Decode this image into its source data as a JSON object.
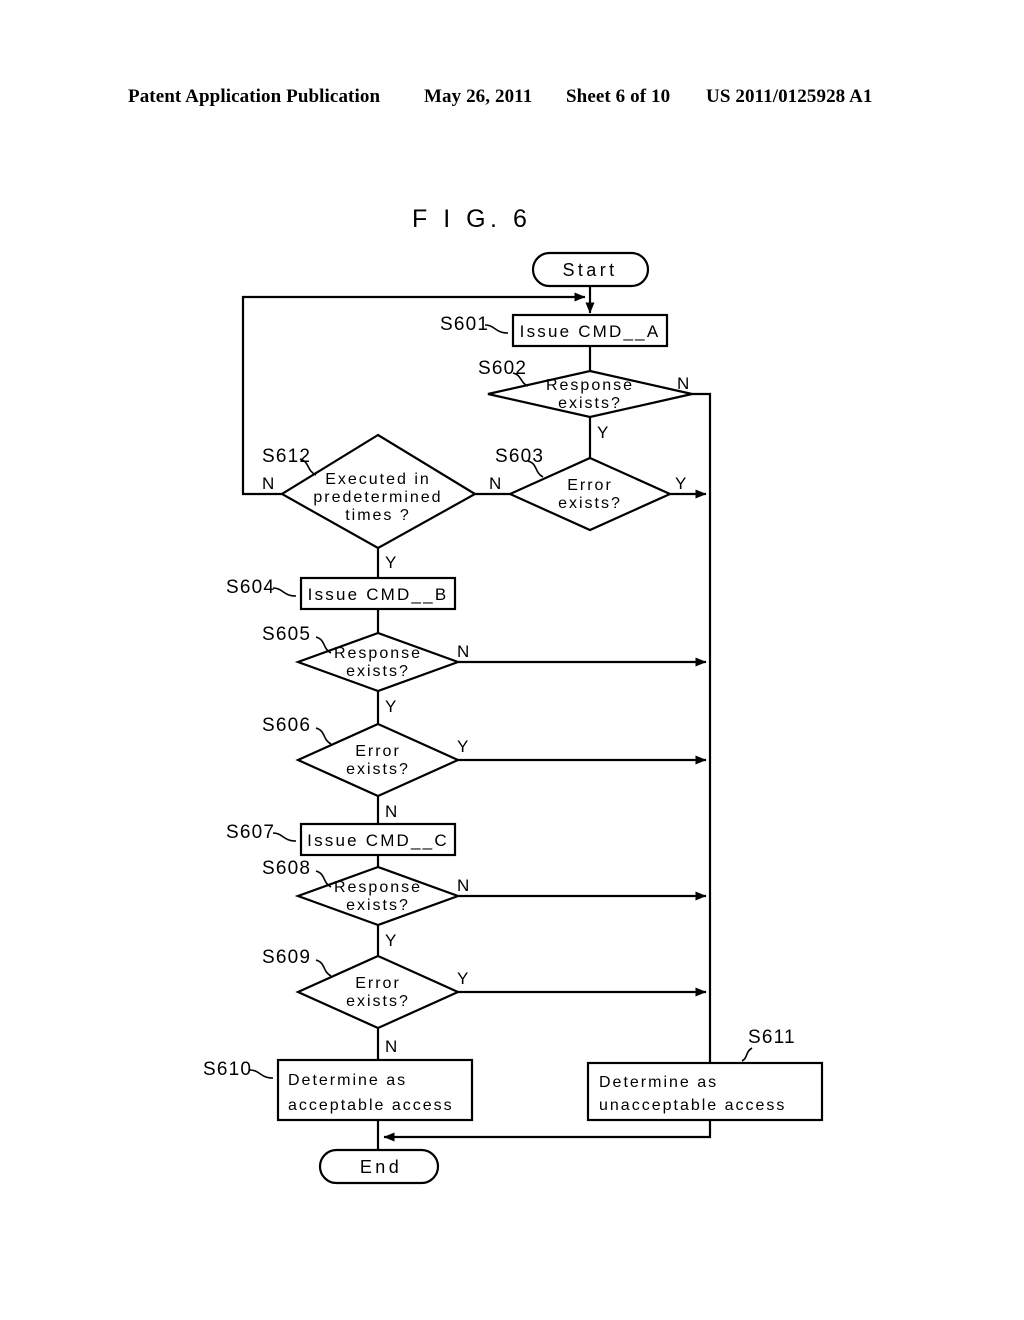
{
  "header": {
    "publication": "Patent Application Publication",
    "date": "May 26, 2011",
    "sheet": "Sheet 6 of 10",
    "number": "US 2011/0125928 A1"
  },
  "figure": {
    "title": "F I G.  6"
  },
  "flowchart": {
    "type": "flowchart",
    "terminals": [
      {
        "id": "start",
        "label": "Start",
        "shape": "stadium"
      },
      {
        "id": "end",
        "label": "End",
        "shape": "stadium"
      }
    ],
    "nodes": [
      {
        "id": "S601",
        "step": "S601",
        "shape": "process",
        "label": "Issue CMD__A"
      },
      {
        "id": "S602",
        "step": "S602",
        "shape": "decision",
        "label_line1": "Response",
        "label_line2": "exists?",
        "yes": "Y",
        "no": "N"
      },
      {
        "id": "S603",
        "step": "S603",
        "shape": "decision",
        "label_line1": "Error",
        "label_line2": "exists?",
        "yes": "Y",
        "no": "N"
      },
      {
        "id": "S612",
        "step": "S612",
        "shape": "decision",
        "label_line1": "Executed in",
        "label_line2": "predetermined",
        "label_line3": "times ?",
        "yes": "Y",
        "no": "N"
      },
      {
        "id": "S604",
        "step": "S604",
        "shape": "process",
        "label": "Issue CMD__B"
      },
      {
        "id": "S605",
        "step": "S605",
        "shape": "decision",
        "label_line1": "Response",
        "label_line2": "exists?",
        "yes": "Y",
        "no": "N"
      },
      {
        "id": "S606",
        "step": "S606",
        "shape": "decision",
        "label_line1": "Error",
        "label_line2": "exists?",
        "yes": "Y",
        "no": "N"
      },
      {
        "id": "S607",
        "step": "S607",
        "shape": "process",
        "label": "Issue CMD__C"
      },
      {
        "id": "S608",
        "step": "S608",
        "shape": "decision",
        "label_line1": "Response",
        "label_line2": "exists?",
        "yes": "Y",
        "no": "N"
      },
      {
        "id": "S609",
        "step": "S609",
        "shape": "decision",
        "label_line1": "Error",
        "label_line2": "exists?",
        "yes": "Y",
        "no": "N"
      },
      {
        "id": "S610",
        "step": "S610",
        "shape": "process",
        "label_line1": "Determine as",
        "label_line2": "acceptable access"
      },
      {
        "id": "S611",
        "step": "S611",
        "shape": "process",
        "label_line1": "Determine as",
        "label_line2": "unacceptable access"
      }
    ],
    "edges": [
      {
        "from": "start",
        "to": "S601",
        "label": ""
      },
      {
        "from": "S601",
        "to": "S602",
        "label": ""
      },
      {
        "from": "S602",
        "to": "S603",
        "label": "Y"
      },
      {
        "from": "S602",
        "to": "S611",
        "label": "N"
      },
      {
        "from": "S603",
        "to": "S612",
        "label": "N"
      },
      {
        "from": "S603",
        "to": "S611",
        "label": "Y"
      },
      {
        "from": "S612",
        "to": "S601",
        "label": "N"
      },
      {
        "from": "S612",
        "to": "S604",
        "label": "Y"
      },
      {
        "from": "S604",
        "to": "S605",
        "label": ""
      },
      {
        "from": "S605",
        "to": "S606",
        "label": "Y"
      },
      {
        "from": "S605",
        "to": "S611",
        "label": "N"
      },
      {
        "from": "S606",
        "to": "S607",
        "label": "N"
      },
      {
        "from": "S606",
        "to": "S611",
        "label": "Y"
      },
      {
        "from": "S607",
        "to": "S608",
        "label": ""
      },
      {
        "from": "S608",
        "to": "S609",
        "label": "Y"
      },
      {
        "from": "S608",
        "to": "S611",
        "label": "N"
      },
      {
        "from": "S609",
        "to": "S610",
        "label": "N"
      },
      {
        "from": "S609",
        "to": "S611",
        "label": "Y"
      },
      {
        "from": "S610",
        "to": "end",
        "label": ""
      },
      {
        "from": "S611",
        "to": "end",
        "label": ""
      }
    ]
  }
}
